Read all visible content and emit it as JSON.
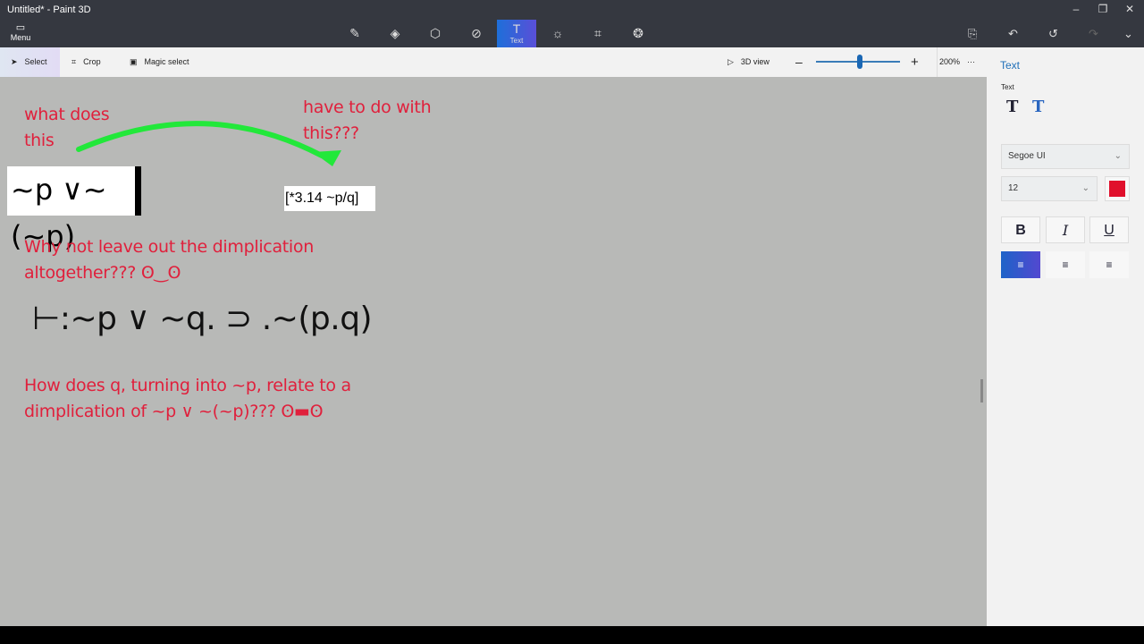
{
  "window": {
    "title": "Untitled* - Paint 3D"
  },
  "header": {
    "menu_label": "Menu",
    "active_tool_label": "Text",
    "tools": [
      "brushes",
      "2d-shapes",
      "3d-shapes",
      "stickers",
      "text",
      "effects",
      "canvas",
      "3d-library"
    ]
  },
  "toolbar": {
    "select": "Select",
    "crop": "Crop",
    "magic_select": "Magic select",
    "view3d": "3D view",
    "zoom": "200%",
    "more": "···"
  },
  "canvas": {
    "note1": "what does\nthis",
    "note2": "have to do with\nthis???",
    "formula1": "~p ∨~(~p)",
    "ref": "[*3.14 ~p/q]",
    "note3": "Why not leave out the dimplication\naltogether??? ʘ‿ʘ",
    "formula2": "⊢:~p ∨ ~q. ⊃ .~(p.q)",
    "note4": "How does q, turning into ~p, relate to a\ndimplication of ~p ∨ ~(~p)??? ʘ▬ʘ",
    "arrow_color": "#22e83a"
  },
  "sidebar": {
    "title": "Text",
    "section": "Text",
    "font": "Segoe UI",
    "size": "12",
    "color": "#e0102c",
    "bold": "B",
    "italic": "I",
    "underline": "U"
  }
}
